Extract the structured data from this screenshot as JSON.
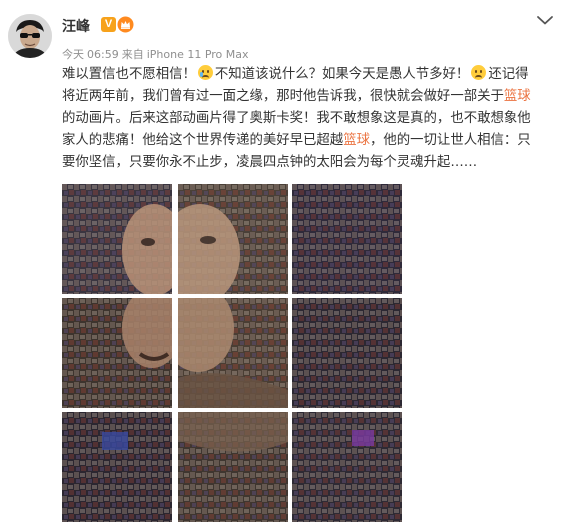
{
  "header": {
    "username": "汪峰",
    "verified_badge": "V",
    "time_day": "今天",
    "time": "06:59",
    "source_prefix": "来自",
    "source_device": "iPhone 11 Pro Max"
  },
  "icons": {
    "avatar": "avatar-photo",
    "verified": "verified-v-icon",
    "member": "crown-icon",
    "menu": "chevron-down-icon",
    "emoji1": "crying-face-emoji",
    "emoji2": "sad-face-emoji"
  },
  "post": {
    "line1_a": "难以置信也不愿相信！",
    "line1_b": "不知道该说什么？如果今天是愚人节多好！",
    "line1_c": "还记得",
    "line2_a": "将近两年前，我们曾有过一面之缘，那时他告诉我，很快就会做好一部关于",
    "line2_link": "篮球",
    "line3": "的动画片。后来这部动画片得了奥斯卡奖！我不敢想象这是真的，也不敢想象他",
    "line4_a": "家人的悲痛！他给这个世界传递的美好早已超越",
    "line4_link": "篮球",
    "line4_b": "，他的一切让世人相信：只",
    "line5": "要你坚信，只要你永不止步，凌晨四点钟的太阳会为每个灵魂升起……"
  },
  "gallery": {
    "tile_count": 9,
    "description_items": [
      "mosaic-tile-1",
      "mosaic-tile-2",
      "mosaic-tile-3",
      "mosaic-tile-4",
      "mosaic-tile-5",
      "mosaic-tile-6",
      "mosaic-tile-7",
      "mosaic-tile-8",
      "mosaic-tile-9"
    ]
  },
  "colors": {
    "text": "#333333",
    "meta": "#8f8f8f",
    "link": "#eb7340",
    "verified": "#f7a21b"
  }
}
